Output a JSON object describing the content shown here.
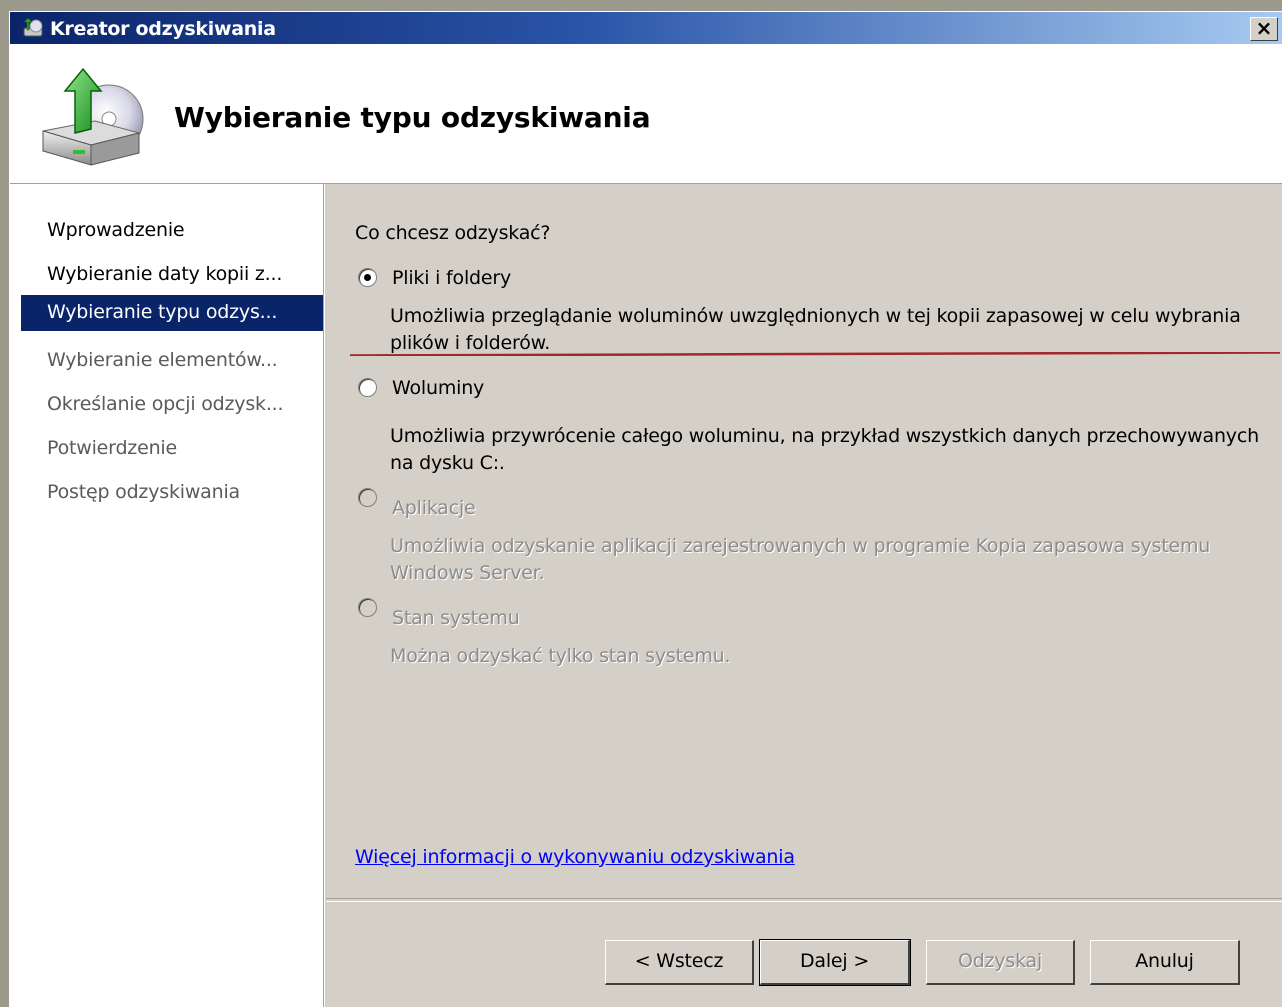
{
  "window": {
    "title": "Kreator odzyskiwania",
    "close_glyph": "×",
    "title_icon": "backup-wizard-icon"
  },
  "header": {
    "title": "Wybieranie typu odzyskiwania",
    "icon": "disk-restore-icon"
  },
  "nav": {
    "items": [
      {
        "label": "Wprowadzenie",
        "state": "done"
      },
      {
        "label": "Wybieranie daty kopii z...",
        "state": "done"
      },
      {
        "label": "Wybieranie typu odzys...",
        "state": "active"
      },
      {
        "label": "Wybieranie elementów...",
        "state": "todo"
      },
      {
        "label": "Określanie opcji odzysk...",
        "state": "todo"
      },
      {
        "label": "Potwierdzenie",
        "state": "todo"
      },
      {
        "label": "Postęp odzyskiwania",
        "state": "todo"
      }
    ]
  },
  "content": {
    "question": "Co chcesz odzyskać?",
    "options": [
      {
        "label": "Pliki i foldery",
        "description": "Umożliwia przeglądanie woluminów uwzględnionych w tej kopii zapasowej w celu wybrania plików i folderów.",
        "selected": true,
        "enabled": true
      },
      {
        "label": "Woluminy",
        "description": "Umożliwia przywrócenie całego woluminu, na przykład wszystkich danych przechowywanych na dysku C:.",
        "selected": false,
        "enabled": true
      },
      {
        "label": "Aplikacje",
        "description": "Umożliwia odzyskanie aplikacji zarejestrowanych w programie Kopia zapasowa systemu Windows Server.",
        "selected": false,
        "enabled": false
      },
      {
        "label": "Stan systemu",
        "description": "Można odzyskać tylko stan systemu.",
        "selected": false,
        "enabled": false
      }
    ],
    "more_info_link": "Więcej informacji o wykonywaniu odzyskiwania",
    "annotation_color": "#a0282a"
  },
  "buttons": {
    "back": "< Wstecz",
    "next": "Dalej >",
    "recover": "Odzyskaj",
    "cancel": "Anuluj"
  },
  "colors": {
    "selection": "#0a246a",
    "link": "#0000ff",
    "dialog_bg": "#d4d0c8"
  }
}
